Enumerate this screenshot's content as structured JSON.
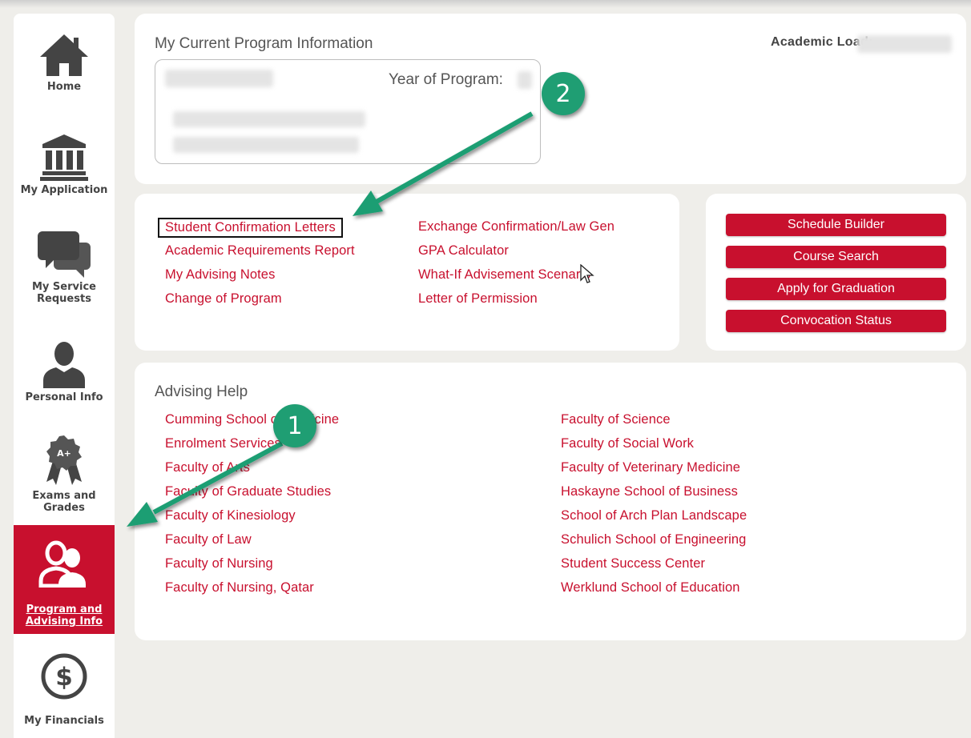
{
  "sidebar": {
    "items": [
      {
        "label": "Home",
        "icon": "home-icon"
      },
      {
        "label": "My Application",
        "icon": "institution-icon"
      },
      {
        "label": "My Service Requests",
        "icon": "chat-bubbles-icon"
      },
      {
        "label": "Personal Info",
        "icon": "person-icon"
      },
      {
        "label": "Exams and Grades",
        "icon": "award-badge-icon",
        "badge_text": "A+"
      },
      {
        "label": "Program and Advising Info",
        "icon": "users-icon",
        "active": true
      },
      {
        "label": "My Financials",
        "icon": "dollar-circle-icon"
      }
    ]
  },
  "program": {
    "title": "My Current Program Information",
    "academic_load_label": "Academic Load:",
    "year_label": "Year of Program:"
  },
  "links": {
    "col1": [
      "Student Confirmation Letters",
      "Academic Requirements Report",
      "My Advising Notes",
      "Change of Program"
    ],
    "col2": [
      "Exchange Confirmation/Law Gen",
      "GPA Calculator",
      "What-If Advisement Scenario",
      "Letter of Permission"
    ]
  },
  "buttons": [
    "Schedule Builder",
    "Course Search",
    "Apply for Graduation",
    "Convocation Status"
  ],
  "advising": {
    "title": "Advising Help",
    "col1": [
      "Cumming School of Medicine",
      "Enrolment Services",
      "Faculty of Arts",
      "Faculty of Graduate Studies",
      "Faculty of Kinesiology",
      "Faculty of Law",
      "Faculty of Nursing",
      "Faculty of Nursing, Qatar"
    ],
    "col2": [
      "Faculty of Science",
      "Faculty of Social Work",
      "Faculty of Veterinary Medicine",
      "Haskayne School of Business",
      "School of Arch Plan Landscape",
      "Schulich School of Engineering",
      "Student Success Center",
      "Werklund School of Education"
    ]
  },
  "annotations": {
    "badge1": "1",
    "badge2": "2",
    "color": "#1f9e73"
  },
  "colors": {
    "brand_red": "#c8102e",
    "background": "#efeeea"
  }
}
